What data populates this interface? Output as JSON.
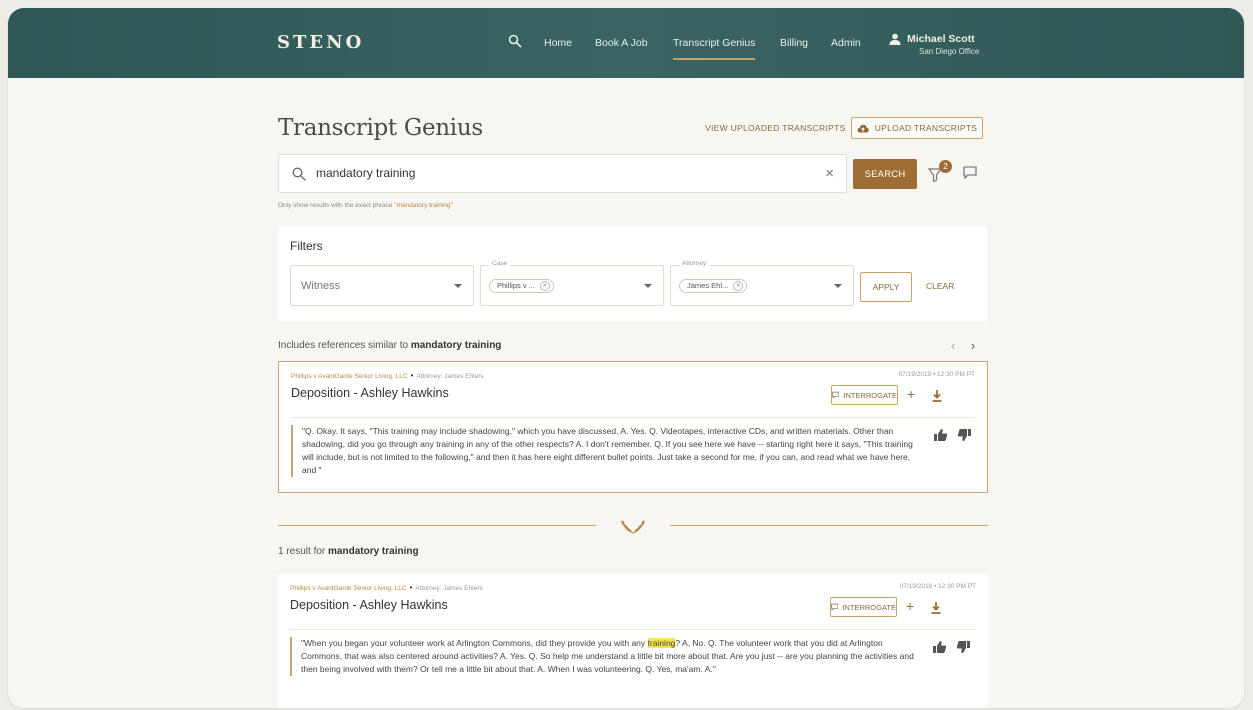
{
  "brand": {
    "logo": "STENO"
  },
  "nav": {
    "items": [
      {
        "label": "Home",
        "active": false
      },
      {
        "label": "Book A Job",
        "active": false
      },
      {
        "label": "Transcript Genius",
        "active": true
      },
      {
        "label": "Billing",
        "active": false
      },
      {
        "label": "Admin",
        "active": false
      }
    ],
    "user": {
      "name": "Michael Scott",
      "office": "San Diego Office"
    }
  },
  "page": {
    "title": "Transcript Genius",
    "view_uploaded_label": "VIEW UPLOADED TRANSCRIPTS",
    "upload_label": "UPLOAD TRANSCRIPTS"
  },
  "search": {
    "value": "mandatory training",
    "button_label": "SEARCH",
    "filter_badge_count": "2",
    "exact_phrase_prefix": "Only show results with the exact phrase",
    "exact_phrase_quoted": "\"mandatory training\""
  },
  "filters": {
    "title": "Filters",
    "witness_placeholder": "Witness",
    "case_legend": "Case",
    "case_chip": "Phillips v ...",
    "attorney_legend": "Attorney",
    "attorney_chip": "James Ehl...",
    "apply_label": "APPLY",
    "clear_label": "CLEAR"
  },
  "similar_section": {
    "prefix": "Includes references similar to",
    "term": "mandatory training"
  },
  "results_section": {
    "prefix": "1 result for",
    "term": "mandatory training"
  },
  "cards": [
    {
      "case": "Phillips v AvantGarde Senior Living, LLC",
      "attorney_label": "Attorney:",
      "attorney": "James Ehlers",
      "date": "07/19/2019 • 12:30 PM PT",
      "title": "Deposition - Ashley Hawkins",
      "interrogate_label": "INTERROGATE",
      "quote": "\"Q. Okay. It says, \"This training may include shadowing,\" which you have discussed. A. Yes. Q. Videotapes, interactive CDs, and written materials. Other than shadowing, did you go through any training in any of the other respects? A. I don't remember. Q. If you see here we have -- starting right here it says, \"This training will include, but is not limited to the following,\" and then it has here eight different bullet points. Just take a second for me, if you can, and read what we have here, and \""
    },
    {
      "case": "Phillips v AvantGarde Senior Living, LLC",
      "attorney_label": "Attorney:",
      "attorney": "James Ehlers",
      "date": "07/19/2019 • 12:30 PM PT",
      "title": "Deposition - Ashley Hawkins",
      "interrogate_label": "INTERROGATE",
      "quote_before": "\"When you began your volunteer work at Arlington Commons, did they provide you with any ",
      "quote_highlight": "training",
      "quote_after": "? A. No. Q. The volunteer work that you did at Arlington Commons, that was also centered around activities? A. Yes. Q. So help me understand a little bit more about that. Are you just -- are you planning the activities and then being involved with them? Or tell me a little bit about that. A. When I was volunteering. Q. Yes, ma'am. A.\""
    }
  ],
  "icons": {
    "search": "search-icon",
    "user": "user-icon",
    "upload": "cloud-upload-icon",
    "filter": "filter-icon",
    "chat": "chat-icon",
    "download": "download-icon",
    "thumbs_up": "thumbs-up-icon",
    "thumbs_down": "thumbs-down-icon",
    "ornament": "laurel-ornament-icon"
  },
  "colors": {
    "header": "#2e5754",
    "accent": "#9e6d33",
    "border_accent": "#c9a36d",
    "highlight": "#f7e54b"
  }
}
